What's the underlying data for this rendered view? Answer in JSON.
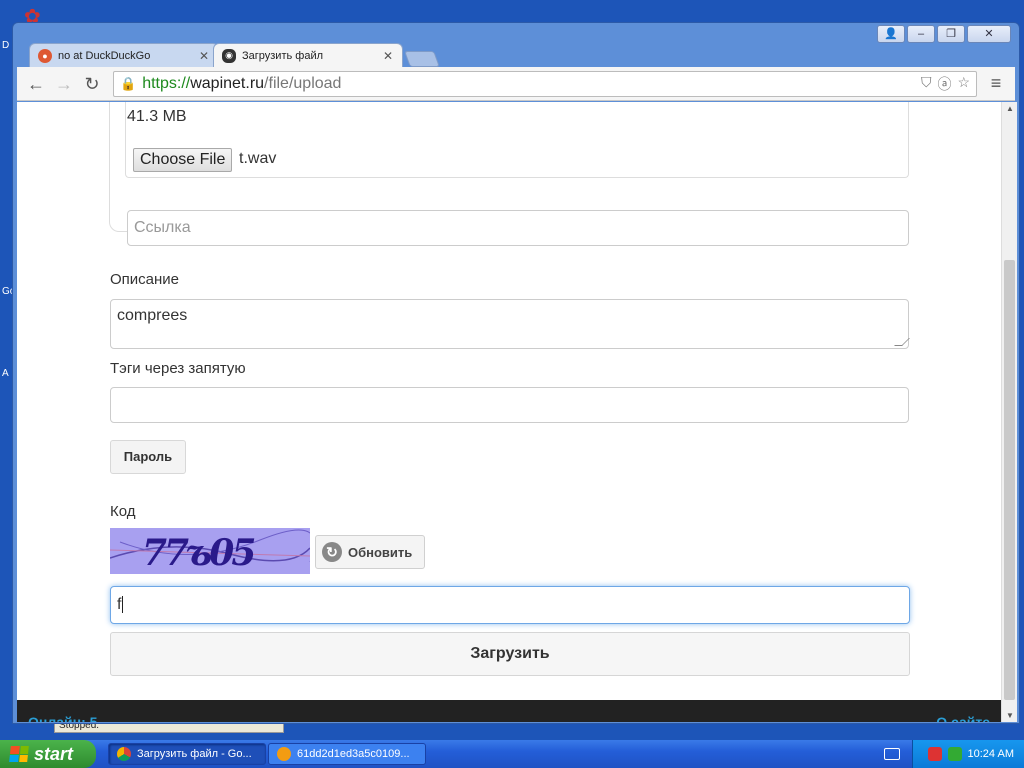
{
  "desktop": {
    "icon_text_1": "D",
    "icon_text_2": "Go",
    "icon_text_3": "A",
    "status_strip": "Stopped."
  },
  "window": {
    "controls": [
      "user-icon",
      "minimize-icon",
      "restore-icon",
      "close-icon"
    ]
  },
  "tabs": [
    {
      "title": "no at DuckDuckGo",
      "icon": "duckduckgo-icon",
      "active": false
    },
    {
      "title": "Загрузить файл",
      "icon": "eye-icon",
      "active": true
    }
  ],
  "toolbar": {
    "url_scheme": "https://",
    "url_host": "wapinet.ru",
    "url_path": "/file/upload"
  },
  "form": {
    "file_size": "41.3 MB",
    "choose_file_label": "Choose File",
    "file_name": "t.wav",
    "link_placeholder": "Ссылка",
    "description_label": "Описание",
    "description_value": "comprees",
    "tags_label": "Тэги через запятую",
    "tags_value": "",
    "password_button": "Пароль",
    "code_label": "Код",
    "captcha_text": "77ъ05",
    "refresh_button": "Обновить",
    "code_value": "f",
    "submit_button": "Загрузить"
  },
  "footer": {
    "online": "Онлайн: 5",
    "about": "О сайте"
  },
  "taskbar": {
    "start_label": "start",
    "items": [
      {
        "label": "Загрузить файл - Go...",
        "icon": "chrome-icon",
        "active": true
      },
      {
        "label": "61dd2d1ed3a5c0109...",
        "icon": "audio-file-icon",
        "active": false
      }
    ],
    "clock": "10:24 AM"
  },
  "colors": {
    "link": "#2a9fd6",
    "footer_bg": "#222222",
    "taskbar": "#245ed8",
    "url_green": "#1e8a1e"
  }
}
